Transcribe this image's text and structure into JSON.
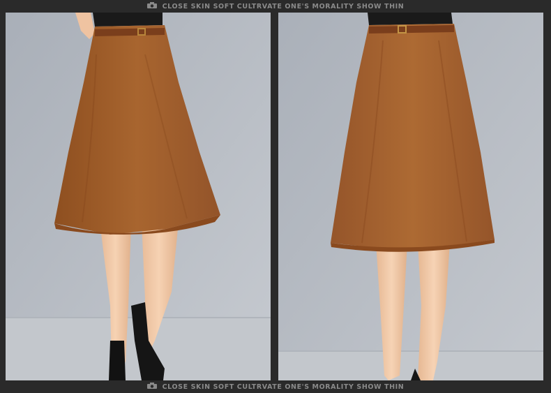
{
  "banner": {
    "icon": "camera-icon",
    "top_text": "CLOSE SKIN SOFT CULTRVATE ONE'S MORALITY SHOW THIN",
    "bottom_text": "CLOSE SKIN SOFT CULTRVATE ONE'S MORALITY SHOW THIN"
  },
  "colors": {
    "frame": "#2a2a2a",
    "background_wall": "#b9bec6",
    "floor": "#c4c8cd",
    "skirt": "#a3622d",
    "belt": "#7a3e1c",
    "skin": "#f1c8a5",
    "shoe": "#111111"
  }
}
